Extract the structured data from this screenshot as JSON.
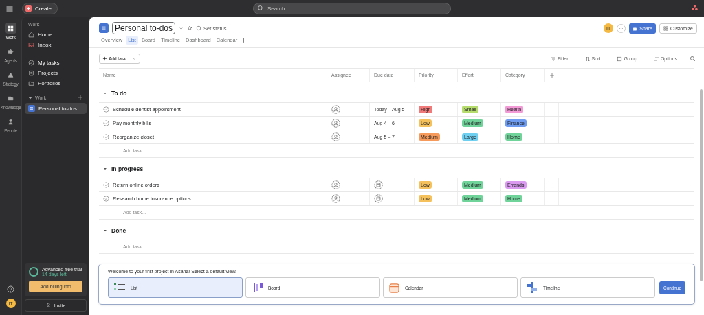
{
  "topbar": {
    "create": "Create",
    "search_placeholder": "Search"
  },
  "rail": [
    {
      "label": "Work",
      "selected": true
    },
    {
      "label": "Agents",
      "selected": false
    },
    {
      "label": "Strategy",
      "selected": false
    },
    {
      "label": "Knowledge",
      "selected": false
    },
    {
      "label": "People",
      "selected": false
    }
  ],
  "rail_avatar": "IT",
  "sidebar": {
    "heading": "Work",
    "items": [
      {
        "label": "Home",
        "selected": false
      },
      {
        "label": "Inbox",
        "selected": false
      }
    ],
    "items2": [
      {
        "label": "My tasks",
        "selected": false
      },
      {
        "label": "Projects",
        "selected": false
      },
      {
        "label": "Portfolios",
        "selected": false
      }
    ],
    "section": "Work",
    "projects": [
      {
        "label": "Personal to-dos",
        "selected": true
      }
    ],
    "trial_title": "Advanced free trial",
    "trial_days": "14 days left",
    "billing": "Add billing info",
    "invite": "Invite"
  },
  "project": {
    "title": "Personal to-dos",
    "status": "Set status",
    "avatar": "IT",
    "share": "Share",
    "customize": "Customize",
    "tabs": [
      {
        "label": "Overview",
        "selected": false
      },
      {
        "label": "List",
        "selected": true
      },
      {
        "label": "Board",
        "selected": false
      },
      {
        "label": "Timeline",
        "selected": false
      },
      {
        "label": "Dashboard",
        "selected": false
      },
      {
        "label": "Calendar",
        "selected": false
      }
    ]
  },
  "toolbar": {
    "add_task": "Add task",
    "actions": [
      "Filter",
      "Sort",
      "Group",
      "Options"
    ]
  },
  "columns": [
    "Name",
    "Assignee",
    "Due date",
    "Priority",
    "Effort",
    "Category"
  ],
  "sections": [
    {
      "name": "To do",
      "add": "Add task...",
      "tasks": [
        {
          "name": "Schedule dentist appointment",
          "due": "Today – Aug 5",
          "priority": {
            "text": "High",
            "color": "#f07a7a"
          },
          "effort": {
            "text": "Small",
            "color": "#b6dc6e"
          },
          "category": {
            "text": "Health",
            "color": "#f29ad6"
          }
        },
        {
          "name": "Pay monthly bills",
          "due": "Aug 4 – 6",
          "priority": {
            "text": "Low",
            "color": "#f5c15c"
          },
          "effort": {
            "text": "Medium",
            "color": "#6fd39a"
          },
          "category": {
            "text": "Finance",
            "color": "#6d9cf0"
          }
        },
        {
          "name": "Reorganize closet",
          "due": "Aug 5 – 7",
          "priority": {
            "text": "Medium",
            "color": "#f59a5a"
          },
          "effort": {
            "text": "Large",
            "color": "#6ecff0"
          },
          "category": {
            "text": "Home",
            "color": "#6fd39a"
          }
        }
      ]
    },
    {
      "name": "In progress",
      "add": "Add task...",
      "tasks": [
        {
          "name": "Return online orders",
          "priority": {
            "text": "Low",
            "color": "#f5c15c"
          },
          "effort": {
            "text": "Medium",
            "color": "#6fd39a"
          },
          "category": {
            "text": "Errands",
            "color": "#d99af0"
          }
        },
        {
          "name": "Research home insurance options",
          "priority": {
            "text": "Low",
            "color": "#f5c15c"
          },
          "effort": {
            "text": "Medium",
            "color": "#6fd39a"
          },
          "category": {
            "text": "Home",
            "color": "#6fd39a"
          }
        }
      ]
    },
    {
      "name": "Done",
      "add": "Add task..."
    }
  ],
  "welcome": {
    "message": "Welcome to your first project in Asana! Select a default view.",
    "continue": "Continue",
    "views": [
      {
        "label": "List",
        "kind": "list",
        "selected": true
      },
      {
        "label": "Board",
        "kind": "board",
        "selected": false
      },
      {
        "label": "Calendar",
        "kind": "calendar",
        "selected": false
      },
      {
        "label": "Timeline",
        "kind": "timeline",
        "selected": false
      }
    ]
  }
}
